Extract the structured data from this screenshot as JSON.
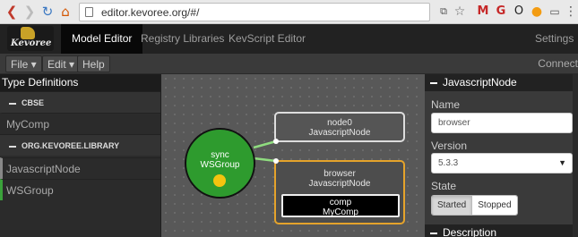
{
  "browser": {
    "url": "editor.kevoree.org/#/",
    "colors": {
      "back": "#c0392b",
      "forward": "#bbbbbb",
      "refresh": "#3b78c2",
      "home": "#d35400"
    },
    "extensions": [
      "translate-icon",
      "bookmark-star-icon",
      "gmail-icon",
      "google-icon",
      "opera-icon",
      "extension-user-icon",
      "cast-icon",
      "menu-icon"
    ]
  },
  "navbar": {
    "brand": "Kevoree",
    "items": [
      {
        "label": "Model Editor",
        "active": true
      },
      {
        "label": "Registry Libraries",
        "active": false
      },
      {
        "label": "KevScript Editor",
        "active": false
      }
    ],
    "settings": "Settings"
  },
  "menubar": {
    "file": "File ▾",
    "edit": "Edit ▾",
    "help": "Help",
    "connect": "Connect"
  },
  "sidebar": {
    "title": "Type Definitions",
    "groups": [
      {
        "name": "CBSE",
        "items": [
          "MyComp"
        ]
      },
      {
        "name": "ORG.KEVOREE.LIBRARY",
        "items": [
          "JavascriptNode",
          "WSGroup"
        ]
      }
    ]
  },
  "canvas": {
    "group": {
      "name": "sync",
      "type": "WSGroup",
      "color": "#2e9b2e"
    },
    "nodes": [
      {
        "name": "node0",
        "type": "JavascriptNode",
        "selected": false
      },
      {
        "name": "browser",
        "type": "JavascriptNode",
        "selected": true,
        "component": {
          "name": "comp",
          "type": "MyComp"
        }
      }
    ],
    "selection_color": "#e5a32b",
    "link_color": "#8fdc7f"
  },
  "panel": {
    "title": "JavascriptNode",
    "name_label": "Name",
    "name_value": "browser",
    "version_label": "Version",
    "version_value": "5.3.3",
    "state_label": "State",
    "state_started": "Started",
    "state_stopped": "Stopped",
    "description_title": "Description"
  }
}
